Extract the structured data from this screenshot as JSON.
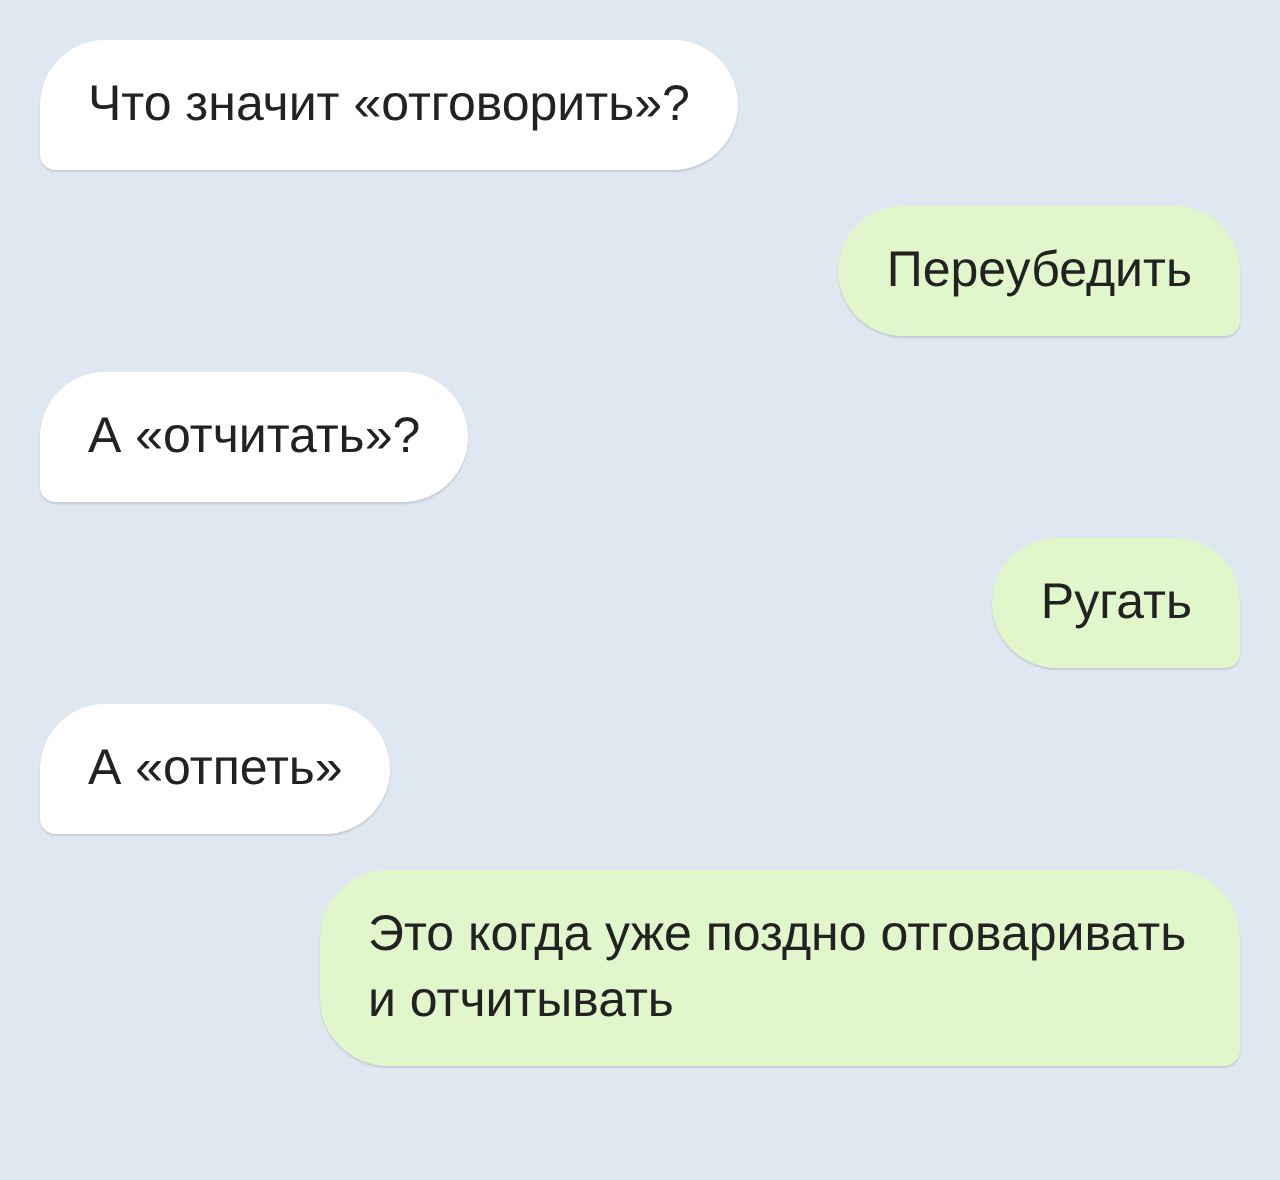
{
  "messages": [
    {
      "kind": "incoming",
      "text": "Что значит «отговорить»?"
    },
    {
      "kind": "outgoing",
      "text": "Переубедить"
    },
    {
      "kind": "incoming",
      "text": "А «отчитать»?"
    },
    {
      "kind": "outgoing",
      "text": "Ругать"
    },
    {
      "kind": "incoming",
      "text": "А «отпеть»"
    },
    {
      "kind": "outgoing",
      "text": "Это когда уже поздно отговаривать и отчитывать"
    }
  ]
}
